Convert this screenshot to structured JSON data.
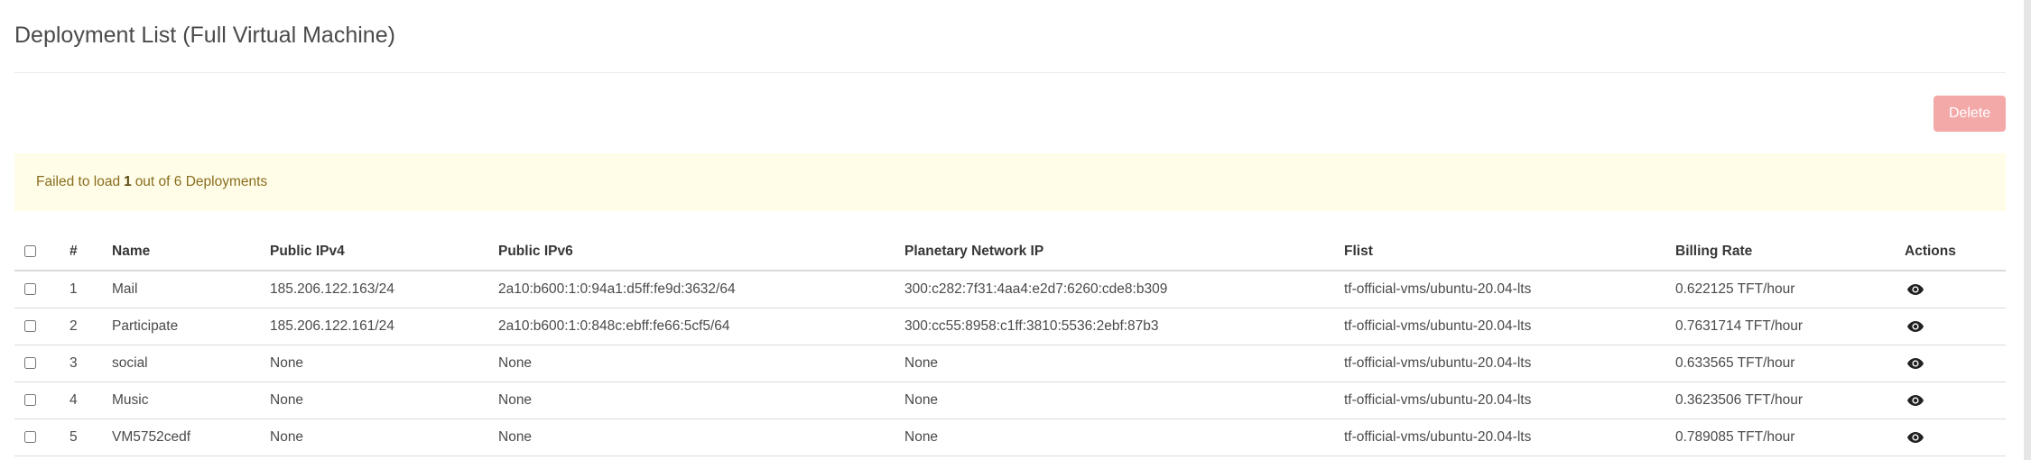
{
  "page_title": "Deployment List (Full Virtual Machine)",
  "toolbar": {
    "delete_label": "Delete"
  },
  "alert": {
    "prefix": "Failed to load",
    "count": "1",
    "suffix": "out of 6 Deployments"
  },
  "table": {
    "headers": {
      "num": "#",
      "name": "Name",
      "ipv4": "Public IPv4",
      "ipv6": "Public IPv6",
      "planetary": "Planetary Network IP",
      "flist": "Flist",
      "billing": "Billing Rate",
      "actions": "Actions"
    },
    "rows": [
      {
        "num": "1",
        "name": "Mail",
        "ipv4": "185.206.122.163/24",
        "ipv6": "2a10:b600:1:0:94a1:d5ff:fe9d:3632/64",
        "planetary": "300:c282:7f31:4aa4:e2d7:6260:cde8:b309",
        "flist": "tf-official-vms/ubuntu-20.04-lts",
        "billing": "0.622125 TFT/hour"
      },
      {
        "num": "2",
        "name": "Participate",
        "ipv4": "185.206.122.161/24",
        "ipv6": "2a10:b600:1:0:848c:ebff:fe66:5cf5/64",
        "planetary": "300:cc55:8958:c1ff:3810:5536:2ebf:87b3",
        "flist": "tf-official-vms/ubuntu-20.04-lts",
        "billing": "0.7631714 TFT/hour"
      },
      {
        "num": "3",
        "name": "social",
        "ipv4": "None",
        "ipv6": "None",
        "planetary": "None",
        "flist": "tf-official-vms/ubuntu-20.04-lts",
        "billing": "0.633565 TFT/hour"
      },
      {
        "num": "4",
        "name": "Music",
        "ipv4": "None",
        "ipv6": "None",
        "planetary": "None",
        "flist": "tf-official-vms/ubuntu-20.04-lts",
        "billing": "0.3623506 TFT/hour"
      },
      {
        "num": "5",
        "name": "VM5752cedf",
        "ipv4": "None",
        "ipv6": "None",
        "planetary": "None",
        "flist": "tf-official-vms/ubuntu-20.04-lts",
        "billing": "0.789085 TFT/hour"
      }
    ]
  },
  "icons": {
    "row_action": "eye-icon"
  },
  "colors": {
    "delete_button": "#f4a9a9",
    "alert_background": "#fffde8",
    "alert_text": "#8a6d1f"
  }
}
